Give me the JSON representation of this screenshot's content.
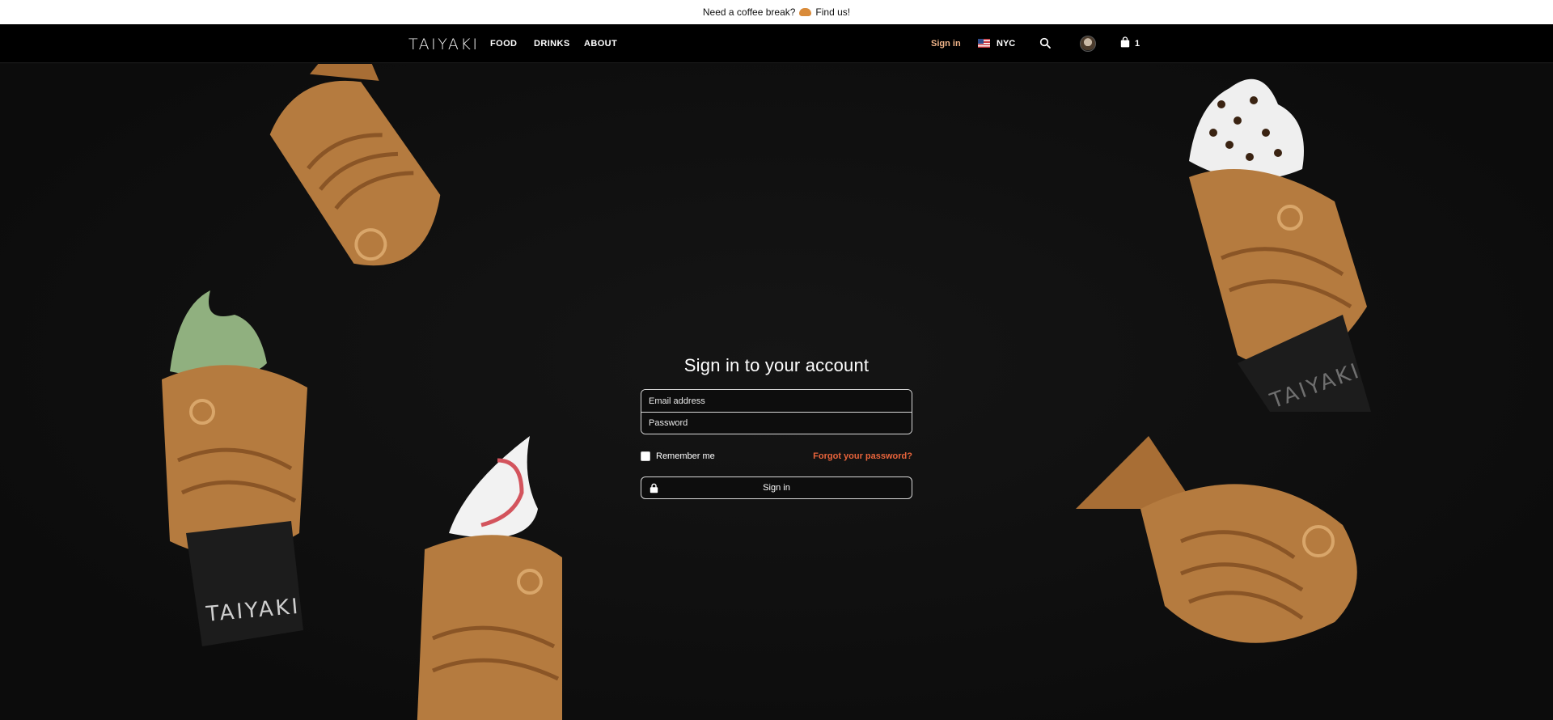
{
  "announcement": {
    "text": "Need a coffee break?",
    "link": "Find us!"
  },
  "nav": {
    "logo": "TAIYAKI",
    "links": [
      "FOOD",
      "DRINKS",
      "ABOUT"
    ],
    "signin": "Sign in",
    "city": "NYC",
    "cart_count": "1"
  },
  "form": {
    "title": "Sign in to your account",
    "email_placeholder": "Email address",
    "password_placeholder": "Password",
    "remember_label": "Remember me",
    "forgot_label": "Forgot your password?",
    "submit_label": "Sign in"
  },
  "colors": {
    "accent": "#e8643b",
    "signin_nav": "#f0b489",
    "background": "#0f0f0f"
  }
}
